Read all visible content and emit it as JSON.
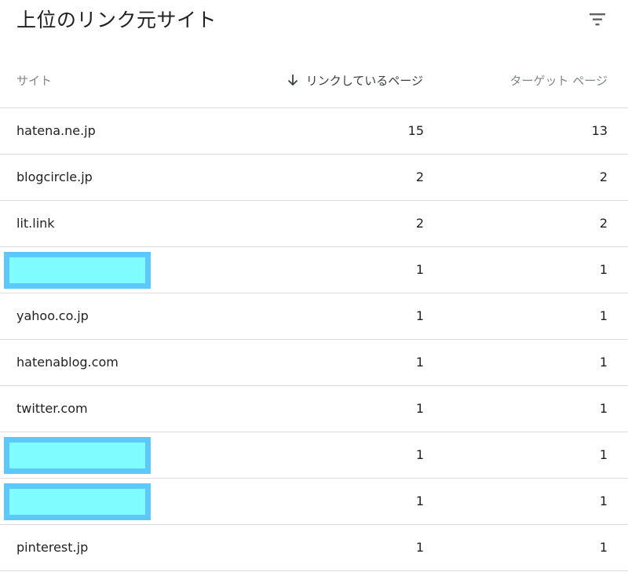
{
  "header": {
    "title": "上位のリンク元サイト",
    "filter_icon": "filter-list-icon"
  },
  "table": {
    "columns": {
      "site": "サイト",
      "linking_pages": "リンクしているページ",
      "target_pages": "ターゲット ページ",
      "sort_icon": "arrow-downward-icon"
    },
    "rows": [
      {
        "site": "hatena.ne.jp",
        "linking_pages": "15",
        "target_pages": "13",
        "redacted": false
      },
      {
        "site": "blogcircle.jp",
        "linking_pages": "2",
        "target_pages": "2",
        "redacted": false
      },
      {
        "site": "lit.link",
        "linking_pages": "2",
        "target_pages": "2",
        "redacted": false
      },
      {
        "site": "",
        "linking_pages": "1",
        "target_pages": "1",
        "redacted": true
      },
      {
        "site": "yahoo.co.jp",
        "linking_pages": "1",
        "target_pages": "1",
        "redacted": false
      },
      {
        "site": "hatenablog.com",
        "linking_pages": "1",
        "target_pages": "1",
        "redacted": false
      },
      {
        "site": "twitter.com",
        "linking_pages": "1",
        "target_pages": "1",
        "redacted": false
      },
      {
        "site": "",
        "linking_pages": "1",
        "target_pages": "1",
        "redacted": true
      },
      {
        "site": "",
        "linking_pages": "1",
        "target_pages": "1",
        "redacted": true
      },
      {
        "site": "pinterest.jp",
        "linking_pages": "1",
        "target_pages": "1",
        "redacted": false
      }
    ]
  },
  "colors": {
    "redaction_fill": "#7ffcff",
    "redaction_border": "#5cc8fb",
    "divider": "#dadce0",
    "header_text": "#80868b"
  }
}
